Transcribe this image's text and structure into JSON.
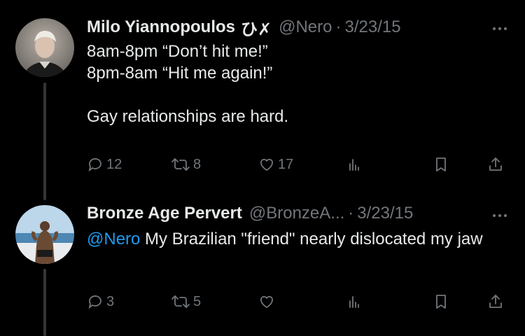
{
  "tweets": [
    {
      "name": "Milo Yiannopoulos",
      "badge": "ひ✗",
      "handle": "@Nero",
      "date": "3/23/15",
      "text_before_mention": "",
      "mention": "",
      "text": "8am-8pm “Don’t hit me!”\n8pm-8am “Hit me again!”\n\nGay relationships are hard.",
      "replies": "12",
      "reposts": "8",
      "likes": "17"
    },
    {
      "name": "Bronze Age Pervert",
      "badge": "",
      "handle": "@BronzeA...",
      "date": "3/23/15",
      "mention": "@Nero",
      "text": " My Brazilian \"friend\" nearly dislocated my jaw",
      "replies": "3",
      "reposts": "5",
      "likes": ""
    }
  ],
  "colors": {
    "background": "#000000",
    "text": "#e7e9ea",
    "secondary": "#71767b",
    "link": "#1d9bf0"
  },
  "icons": [
    "reply-icon",
    "repost-icon",
    "like-icon",
    "views-icon",
    "bookmark-icon",
    "share-icon",
    "more-icon"
  ]
}
